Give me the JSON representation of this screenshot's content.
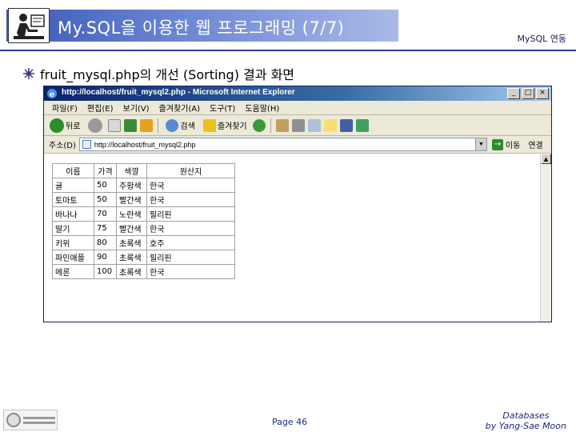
{
  "slide": {
    "title": "My.SQL을 이용한 웹 프로그래밍 (7/7)",
    "topic": "MySQL 연동",
    "bullet": "fruit_mysql.php의 개선 (Sorting) 결과 화면",
    "page": "Page 46",
    "credit_line1": "Databases",
    "credit_line2": "by Yang-Sae Moon"
  },
  "browser": {
    "window_title": "http://localhost/fruit_mysql2.php - Microsoft Internet Explorer",
    "menu": [
      "파일(F)",
      "편집(E)",
      "보기(V)",
      "즐겨찾기(A)",
      "도구(T)",
      "도움말(H)"
    ],
    "toolbar": {
      "back_label": "뒤로",
      "search_label": "검색",
      "favorites_label": "즐겨찾기"
    },
    "address_label": "주소(D)",
    "address_value": "http://localhost/fruit_mysql2.php",
    "go_label": "이동",
    "links_label": "연결"
  },
  "table": {
    "headers": [
      "이름",
      "가격",
      "색깔",
      "원산지"
    ],
    "rows": [
      [
        "귤",
        "50",
        "주황색",
        "한국"
      ],
      [
        "토마토",
        "50",
        "빨간색",
        "한국"
      ],
      [
        "바나나",
        "70",
        "노란색",
        "필리핀"
      ],
      [
        "딸기",
        "75",
        "빨간색",
        "한국"
      ],
      [
        "키위",
        "80",
        "초록색",
        "호주"
      ],
      [
        "파인애플",
        "90",
        "초록색",
        "필리핀"
      ],
      [
        "메론",
        "100",
        "초록색",
        "한국"
      ]
    ]
  },
  "colors": {
    "title_strip": "#3b58b8",
    "title_rule": "#2a3f9e",
    "ie_titlebar": "#0a246a"
  }
}
